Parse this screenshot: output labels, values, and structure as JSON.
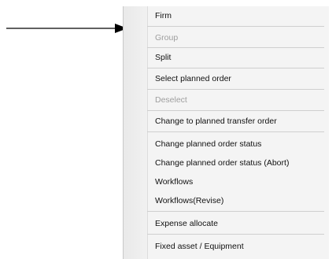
{
  "menu": {
    "items": [
      {
        "label": "Firm",
        "enabled": true
      },
      {
        "label": "Group",
        "enabled": false
      },
      {
        "label": "Split",
        "enabled": true
      },
      {
        "label": "Select planned order",
        "enabled": true
      },
      {
        "label": "Deselect",
        "enabled": false
      },
      {
        "label": "Change to planned transfer order",
        "enabled": true
      },
      {
        "label": "Change planned order status",
        "enabled": true
      },
      {
        "label": "Change planned order status (Abort)",
        "enabled": true
      },
      {
        "label": "Workflows",
        "enabled": true
      },
      {
        "label": "Workflows(Revise)",
        "enabled": true
      },
      {
        "label": "Expense allocate",
        "enabled": true
      },
      {
        "label": "Fixed asset / Equipment",
        "enabled": true
      }
    ]
  },
  "colors": {
    "enabled_text": "#111111",
    "disabled_text": "#9e9e9e",
    "arrow": "#000000"
  }
}
